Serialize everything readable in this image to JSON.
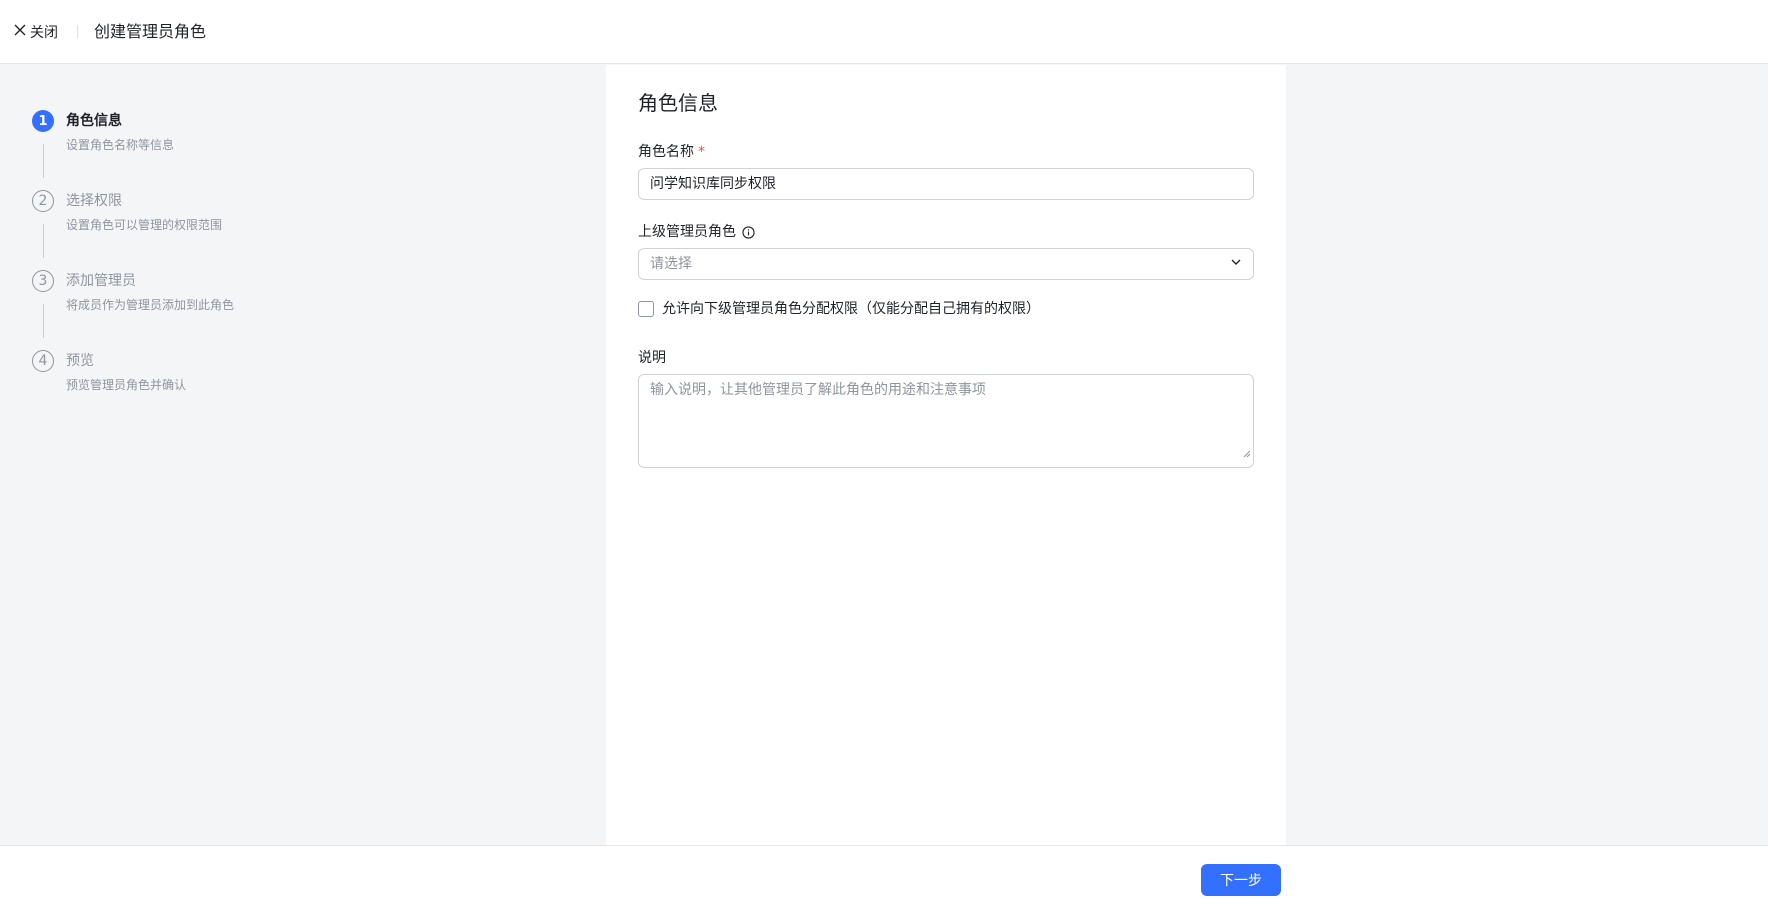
{
  "header": {
    "close_label": "关闭",
    "title": "创建管理员角色"
  },
  "steps": [
    {
      "number": "1",
      "title": "角色信息",
      "desc": "设置角色名称等信息",
      "active": true
    },
    {
      "number": "2",
      "title": "选择权限",
      "desc": "设置角色可以管理的权限范围",
      "active": false
    },
    {
      "number": "3",
      "title": "添加管理员",
      "desc": "将成员作为管理员添加到此角色",
      "active": false
    },
    {
      "number": "4",
      "title": "预览",
      "desc": "预览管理员角色并确认",
      "active": false
    }
  ],
  "form": {
    "section_title": "角色信息",
    "role_name_label": "角色名称",
    "required_mark": "*",
    "role_name_value": "问学知识库同步权限",
    "parent_role_label": "上级管理员角色",
    "parent_role_placeholder": "请选择",
    "allow_assign_label": "允许向下级管理员角色分配权限（仅能分配自己拥有的权限）",
    "allow_assign_checked": false,
    "description_label": "说明",
    "description_placeholder": "输入说明，让其他管理员了解此角色的用途和注意事项"
  },
  "footer": {
    "next_label": "下一步"
  },
  "colors": {
    "accent": "#3370ff",
    "required": "#f54a45",
    "background": "#f4f5f7"
  }
}
